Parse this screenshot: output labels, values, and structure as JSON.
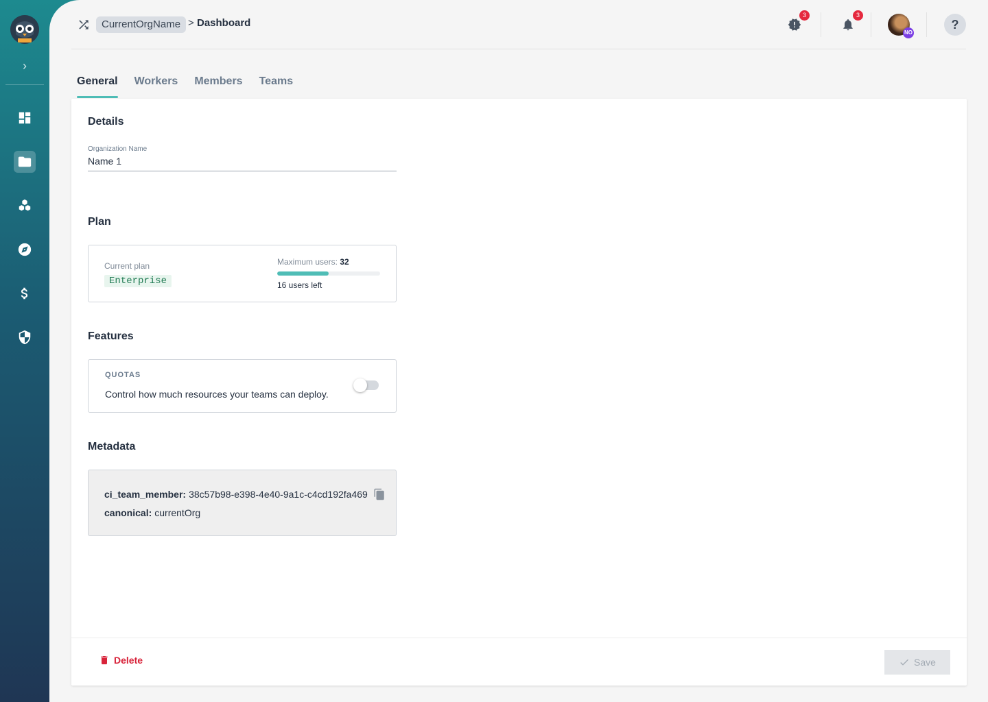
{
  "breadcrumb": {
    "org": "CurrentOrgName",
    "separator": ">",
    "current": "Dashboard"
  },
  "topbar": {
    "alerts_badge": "3",
    "notifications_badge": "3",
    "avatar_initials": "NO",
    "help_label": "?"
  },
  "tabs": [
    {
      "label": "General",
      "active": true
    },
    {
      "label": "Workers",
      "active": false
    },
    {
      "label": "Members",
      "active": false
    },
    {
      "label": "Teams",
      "active": false
    }
  ],
  "details": {
    "title": "Details",
    "org_name_label": "Organization Name",
    "org_name_value": "Name 1"
  },
  "plan": {
    "title": "Plan",
    "current_plan_label": "Current plan",
    "current_plan_value": "Enterprise",
    "max_users_label": "Maximum users:",
    "max_users_value": "32",
    "usage_fraction": 0.5,
    "users_left": "16 users left"
  },
  "features": {
    "title": "Features",
    "quotas_title": "QUOTAS",
    "quotas_description": "Control how much resources your teams can deploy.",
    "quotas_enabled": false
  },
  "metadata": {
    "title": "Metadata",
    "entries": [
      {
        "key": "ci_team_member:",
        "value": "38c57b98-e398-4e40-9a1c-c4cd192fa469"
      },
      {
        "key": "canonical:",
        "value": "currentOrg"
      }
    ]
  },
  "footer": {
    "delete_label": "Delete",
    "save_label": "Save"
  },
  "colors": {
    "accent": "#4fbdb6",
    "danger": "#d8233a",
    "badge": "#e5293e"
  }
}
